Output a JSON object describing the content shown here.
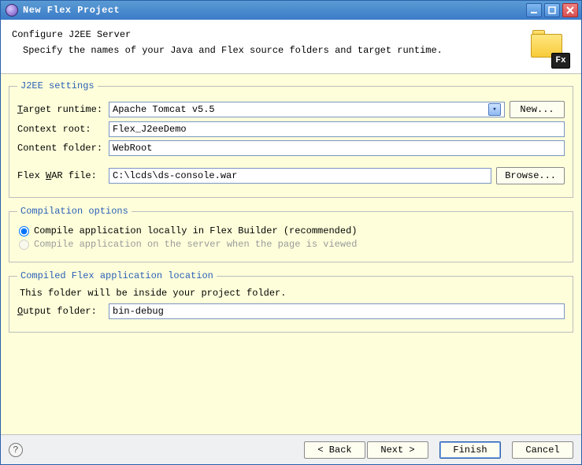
{
  "window": {
    "title": "New Flex Project"
  },
  "header": {
    "title": "Configure J2EE Server",
    "description": "Specify the names of your Java and Flex source folders and target runtime.",
    "fx_badge": "Fx"
  },
  "j2ee": {
    "legend": "J2EE settings",
    "target_runtime_label_pre": "T",
    "target_runtime_label_rest": "arget runtime:",
    "target_runtime_value": "Apache Tomcat v5.5",
    "new_button_pre": "N",
    "new_button_rest": "ew...",
    "context_root_label": "Context root:",
    "context_root_value": "Flex_J2eeDemo",
    "content_folder_label": "Content folder:",
    "content_folder_value": "WebRoot",
    "flex_war_label_pre": "Flex ",
    "flex_war_label_u": "W",
    "flex_war_label_rest": "AR file:",
    "flex_war_value": "C:\\lcds\\ds-console.war",
    "browse_button_pre": "B",
    "browse_button_rest": "rowse..."
  },
  "compile": {
    "legend": "Compilation options",
    "opt_local": "Compile application locally in Flex Builder (recommended)",
    "opt_server": "Compile application on the server when the page is viewed"
  },
  "output": {
    "legend": "Compiled Flex application location",
    "hint": "This folder will be inside your project folder.",
    "label_pre": "O",
    "label_rest": "utput folder:",
    "value": "bin-debug"
  },
  "footer": {
    "back": "< Back",
    "next": "Next >",
    "finish": "Finish",
    "cancel": "Cancel"
  }
}
